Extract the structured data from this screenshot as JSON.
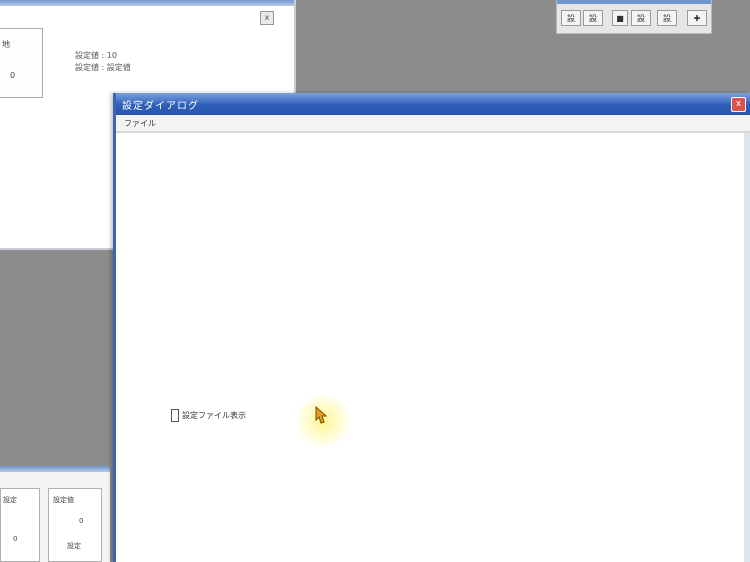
{
  "back_window": {
    "tree_label_1": "地",
    "tree_label_2": "0",
    "info_line_1": "設定値 : 10",
    "info_line_2": "設定値 : 設定値",
    "close_label": "x"
  },
  "toolbar": {
    "buttons": [
      "設",
      "設",
      "■",
      "設",
      "設",
      "✚"
    ]
  },
  "main_window": {
    "title": "設定ダイアログ",
    "close_label": "x",
    "menu": [
      "ファイル"
    ],
    "checkbox_label": "設定ファイル表示"
  },
  "bottom_left": {
    "texts": [
      "設定",
      "設定値",
      "0",
      "設定",
      "0"
    ]
  },
  "colors": {
    "title_bar": "#2e5eb8",
    "desktop": "#8c8c8c",
    "cursor_highlight": "#fff58c",
    "cursor": "#e8a020"
  },
  "icons": {
    "cursor": "pointer-cursor-icon"
  }
}
